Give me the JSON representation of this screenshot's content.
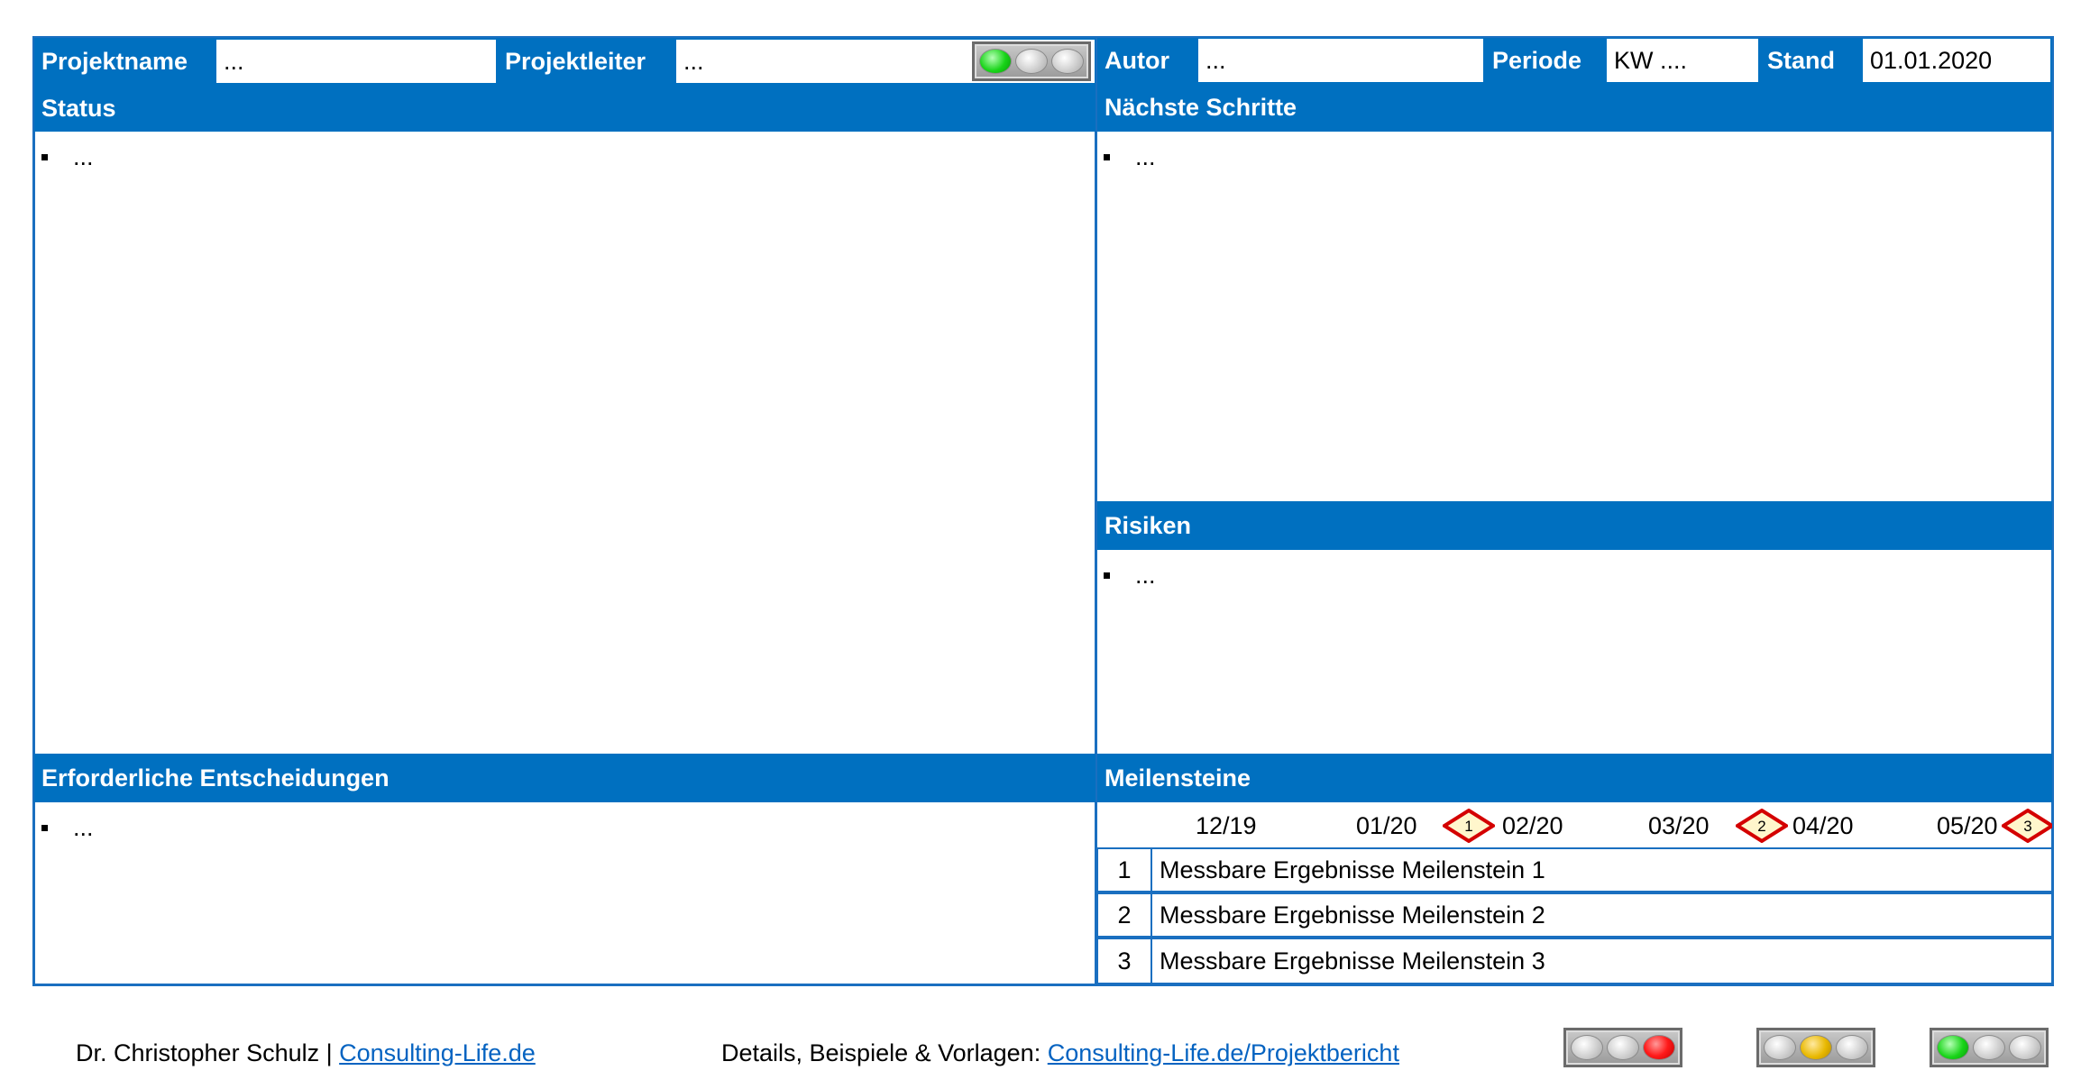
{
  "header": {
    "projektname_label": "Projektname",
    "projektname_value": "...",
    "projektleiter_label": "Projektleiter",
    "projektleiter_value": "...",
    "autor_label": "Autor",
    "autor_value": "...",
    "periode_label": "Periode",
    "periode_value": "KW ....",
    "stand_label": "Stand",
    "stand_value": "01.01.2020",
    "traffic_light": "green"
  },
  "sections": {
    "status": {
      "title": "Status",
      "bullet": "..."
    },
    "naechste_schritte": {
      "title": "Nächste Schritte",
      "bullet": "..."
    },
    "risiken": {
      "title": "Risiken",
      "bullet": "..."
    },
    "entscheidungen": {
      "title": "Erforderliche Entscheidungen",
      "bullet": "..."
    },
    "meilensteine": {
      "title": "Meilensteine"
    }
  },
  "timeline": {
    "months": [
      "12/19",
      "01/20",
      "02/20",
      "03/20",
      "04/20",
      "05/20"
    ],
    "markers": [
      "1",
      "2",
      "3"
    ]
  },
  "milestones": [
    {
      "num": "1",
      "text": "Messbare Ergebnisse Meilenstein 1"
    },
    {
      "num": "2",
      "text": "Messbare Ergebnisse Meilenstein 2"
    },
    {
      "num": "3",
      "text": "Messbare Ergebnisse Meilenstein 3"
    }
  ],
  "footer": {
    "author": "Dr. Christopher Schulz |",
    "author_link": "Consulting-Life.de",
    "details_label": "Details, Beispiele & Vorlagen:",
    "details_link": "Consulting-Life.de/Projektbericht",
    "legend_lights": [
      "red",
      "yellow",
      "green"
    ]
  },
  "colors": {
    "accent_blue": "#0070C0",
    "link_blue": "#0563C1",
    "diamond_red": "#D40000",
    "diamond_fill": "#FFF6CC"
  }
}
